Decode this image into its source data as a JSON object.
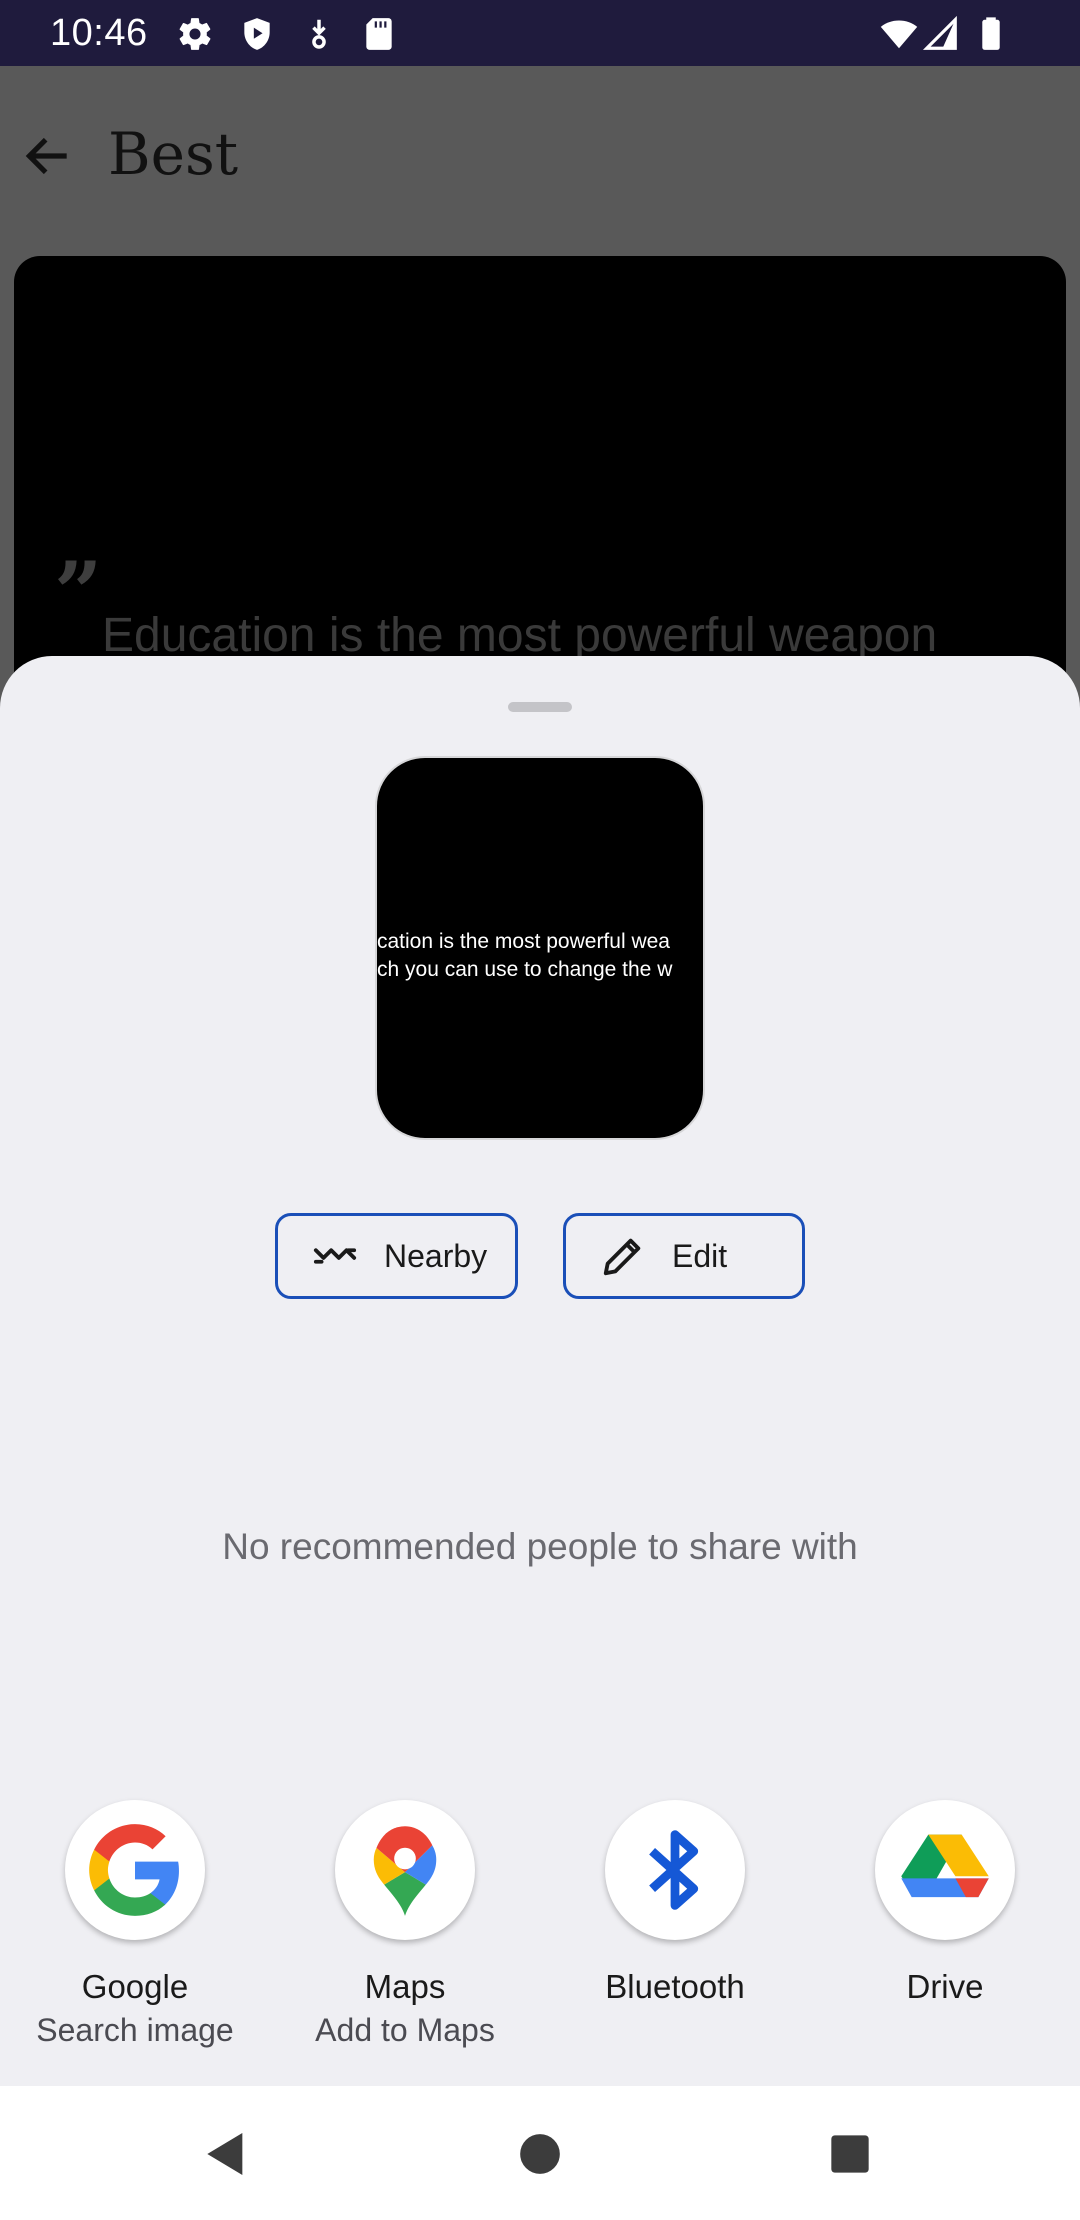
{
  "status_bar": {
    "time": "10:46",
    "icons": [
      "gear-icon",
      "shield-play-icon",
      "download-icon",
      "sd-card-icon",
      "wifi-icon",
      "signal-icon",
      "battery-icon"
    ]
  },
  "app_bar": {
    "title": "Best",
    "back_icon": "back-arrow-icon"
  },
  "background_card": {
    "quote_mark": "”",
    "quote_text": "Education is the most powerful weapon"
  },
  "share_sheet": {
    "preview": {
      "line1": "cation is the most powerful wea",
      "line2": "ch you can use to change the w"
    },
    "chips": [
      {
        "label": "Nearby",
        "icon": "nearby-share-icon"
      },
      {
        "label": "Edit",
        "icon": "pencil-icon"
      }
    ],
    "empty_people_text": "No recommended people to share with",
    "targets": [
      {
        "label": "Google",
        "sublabel": "Search image",
        "icon": "google-g-icon"
      },
      {
        "label": "Maps",
        "sublabel": "Add to Maps",
        "icon": "maps-pin-icon"
      },
      {
        "label": "Bluetooth",
        "sublabel": "",
        "icon": "bluetooth-icon"
      },
      {
        "label": "Drive",
        "sublabel": "",
        "icon": "drive-icon"
      }
    ]
  },
  "nav_bar": {
    "buttons": [
      "back-triangle-icon",
      "home-circle-icon",
      "recents-square-icon"
    ]
  },
  "colors": {
    "status_bar_bg": "#1f1b3d",
    "sheet_bg": "#efeff3",
    "chip_border": "#1a4fb8",
    "scrim_bg": "#595959"
  }
}
